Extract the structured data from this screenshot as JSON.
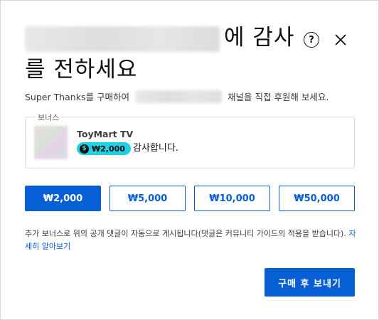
{
  "dialog": {
    "title_line1_suffix": "에 감사",
    "title_line2": "를 전하세요",
    "help_label": "?",
    "description_prefix": "Super Thanks를 구매하여",
    "description_suffix": "채널을 직접 후원해 보세요."
  },
  "bonus": {
    "legend": "보너스",
    "channel_name": "ToyMart TV",
    "amount": "₩2,000",
    "message": "감사합니다."
  },
  "amounts": [
    {
      "label": "₩2,000",
      "selected": true
    },
    {
      "label": "₩5,000",
      "selected": false
    },
    {
      "label": "₩10,000",
      "selected": false
    },
    {
      "label": "₩50,000",
      "selected": false
    }
  ],
  "note": {
    "text": "추가 보너스로 위의 공개 댓글이 자동으로 게시됩니다(댓글은 커뮤니티 가이드의 적용을 받습니다).",
    "link": "자세히 알아보기"
  },
  "actions": {
    "buy_label": "구매 후 보내기"
  },
  "colors": {
    "accent": "#065fd4",
    "chip": "#1fd1e6"
  },
  "icons": [
    "help-icon",
    "close-icon",
    "coin-icon"
  ]
}
